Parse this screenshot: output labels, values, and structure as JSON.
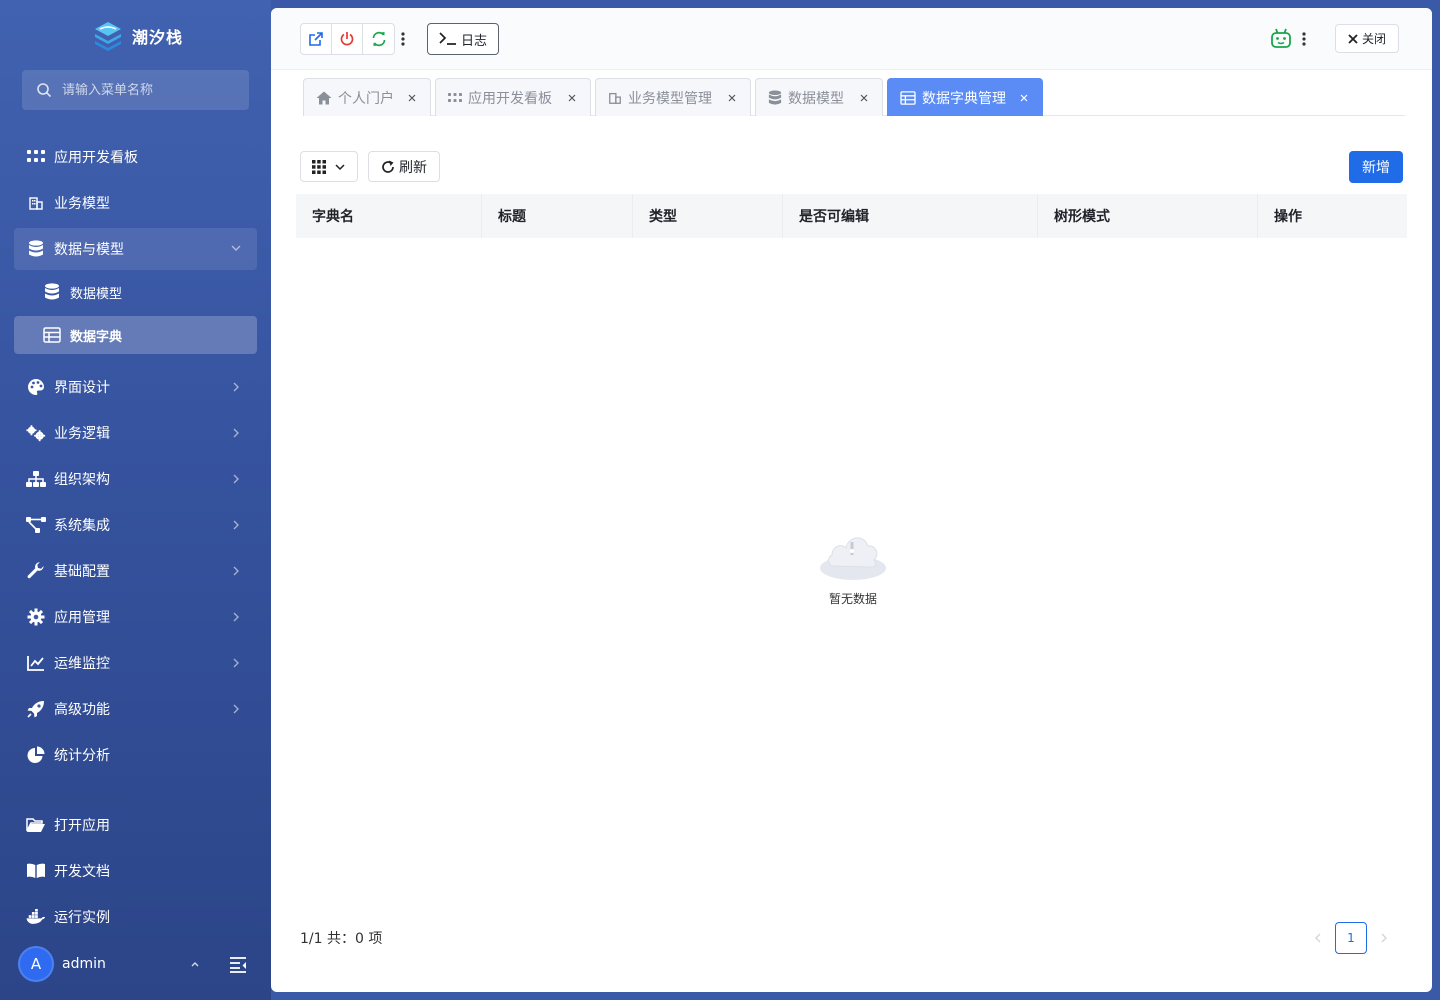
{
  "brand": {
    "name": "潮汐栈"
  },
  "search": {
    "placeholder": "请输入菜单名称"
  },
  "sidebar": {
    "items": [
      {
        "label": "应用开发看板",
        "icon": "grid-dots-icon"
      },
      {
        "label": "业务模型",
        "icon": "building-icon"
      },
      {
        "label": "数据与模型",
        "icon": "database-icon",
        "expanded": true
      },
      {
        "label": "数据模型",
        "icon": "database-icon",
        "sub": true
      },
      {
        "label": "数据字典",
        "icon": "table-icon",
        "sub": true,
        "active": true
      },
      {
        "label": "界面设计",
        "icon": "palette-icon"
      },
      {
        "label": "业务逻辑",
        "icon": "gears-icon"
      },
      {
        "label": "组织架构",
        "icon": "sitemap-icon"
      },
      {
        "label": "系统集成",
        "icon": "nodes-icon"
      },
      {
        "label": "基础配置",
        "icon": "wrench-icon"
      },
      {
        "label": "应用管理",
        "icon": "gear-icon"
      },
      {
        "label": "运维监控",
        "icon": "chart-line-icon"
      },
      {
        "label": "高级功能",
        "icon": "rocket-icon"
      },
      {
        "label": "统计分析",
        "icon": "pie-chart-icon"
      },
      {
        "label": "打开应用",
        "icon": "folder-open-icon"
      },
      {
        "label": "开发文档",
        "icon": "book-icon"
      },
      {
        "label": "运行实例",
        "icon": "docker-icon"
      }
    ],
    "user": {
      "avatar_letter": "A",
      "name": "admin"
    }
  },
  "toolbar": {
    "log_label": "日志",
    "close_label": "关闭"
  },
  "tabs": [
    {
      "label": "个人门户"
    },
    {
      "label": "应用开发看板"
    },
    {
      "label": "业务模型管理"
    },
    {
      "label": "数据模型"
    },
    {
      "label": "数据字典管理",
      "active": true
    }
  ],
  "page": {
    "refresh_label": "刷新",
    "add_label": "新增",
    "columns": [
      "字典名",
      "标题",
      "类型",
      "是否可编辑",
      "树形模式",
      "操作"
    ],
    "empty_text": "暂无数据",
    "total_text": "1/1 共：0 项",
    "current_page": "1"
  },
  "colors": {
    "sidebar_top": "#4162b0",
    "sidebar_bottom": "#2c4588",
    "accent": "#1f6be8",
    "active_tab": "#5b8cf5",
    "power_red": "#e53935",
    "refresh_green": "#19a64a"
  }
}
